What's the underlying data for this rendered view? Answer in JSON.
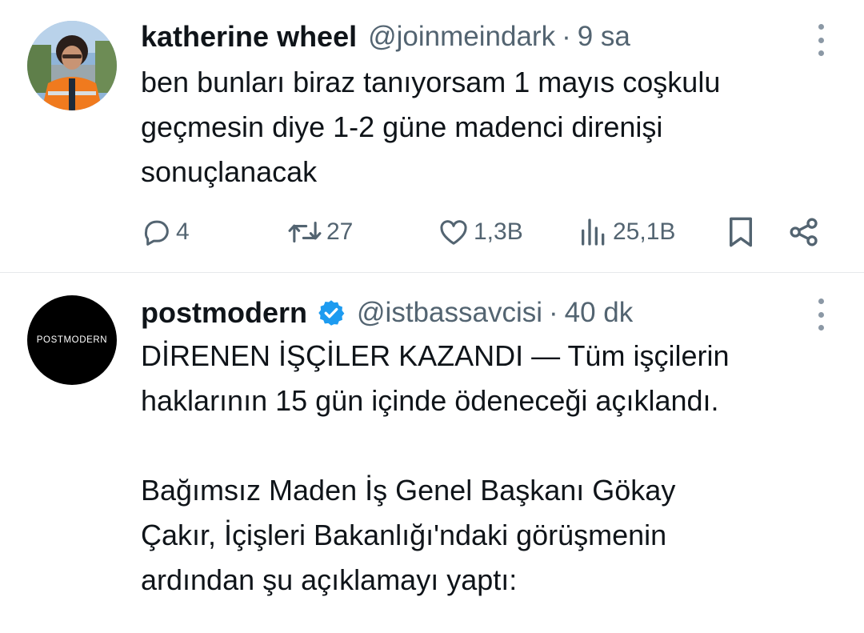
{
  "tweets": [
    {
      "display_name": "katherine wheel",
      "handle": "@joinmeindark",
      "separator": "·",
      "time": "9 sa",
      "text": "ben bunları biraz tanıyorsam 1 mayıs coşkulu\ngeçmesin diye 1-2 güne madenci direnişi\nsonuçlanacak",
      "actions": {
        "replies": "4",
        "retweets": "27",
        "likes": "1,3B",
        "views": "25,1B"
      }
    },
    {
      "display_name": "postmodern",
      "verified": true,
      "handle": "@istbassavcisi",
      "separator": "·",
      "time": "40 dk",
      "avatar_text": "POSTMODERN",
      "text": "DİRENEN İŞÇİLER KAZANDI — Tüm işçilerin\nhaklarının 15 gün içinde ödeneceği açıklandı.\n\nBağımsız Maden İş Genel Başkanı Gökay\nÇakır, İçişleri Bakanlığı'ndaki görüşmenin\nardından şu açıklamayı yaptı:"
    }
  ],
  "colors": {
    "text": "#0f1419",
    "muted": "#536471",
    "verified": "#1d9bf0",
    "divider": "#e6e9eb"
  },
  "icons": [
    "reply-icon",
    "retweet-icon",
    "like-icon",
    "views-icon",
    "bookmark-icon",
    "share-icon",
    "more-icon",
    "verified-icon"
  ]
}
